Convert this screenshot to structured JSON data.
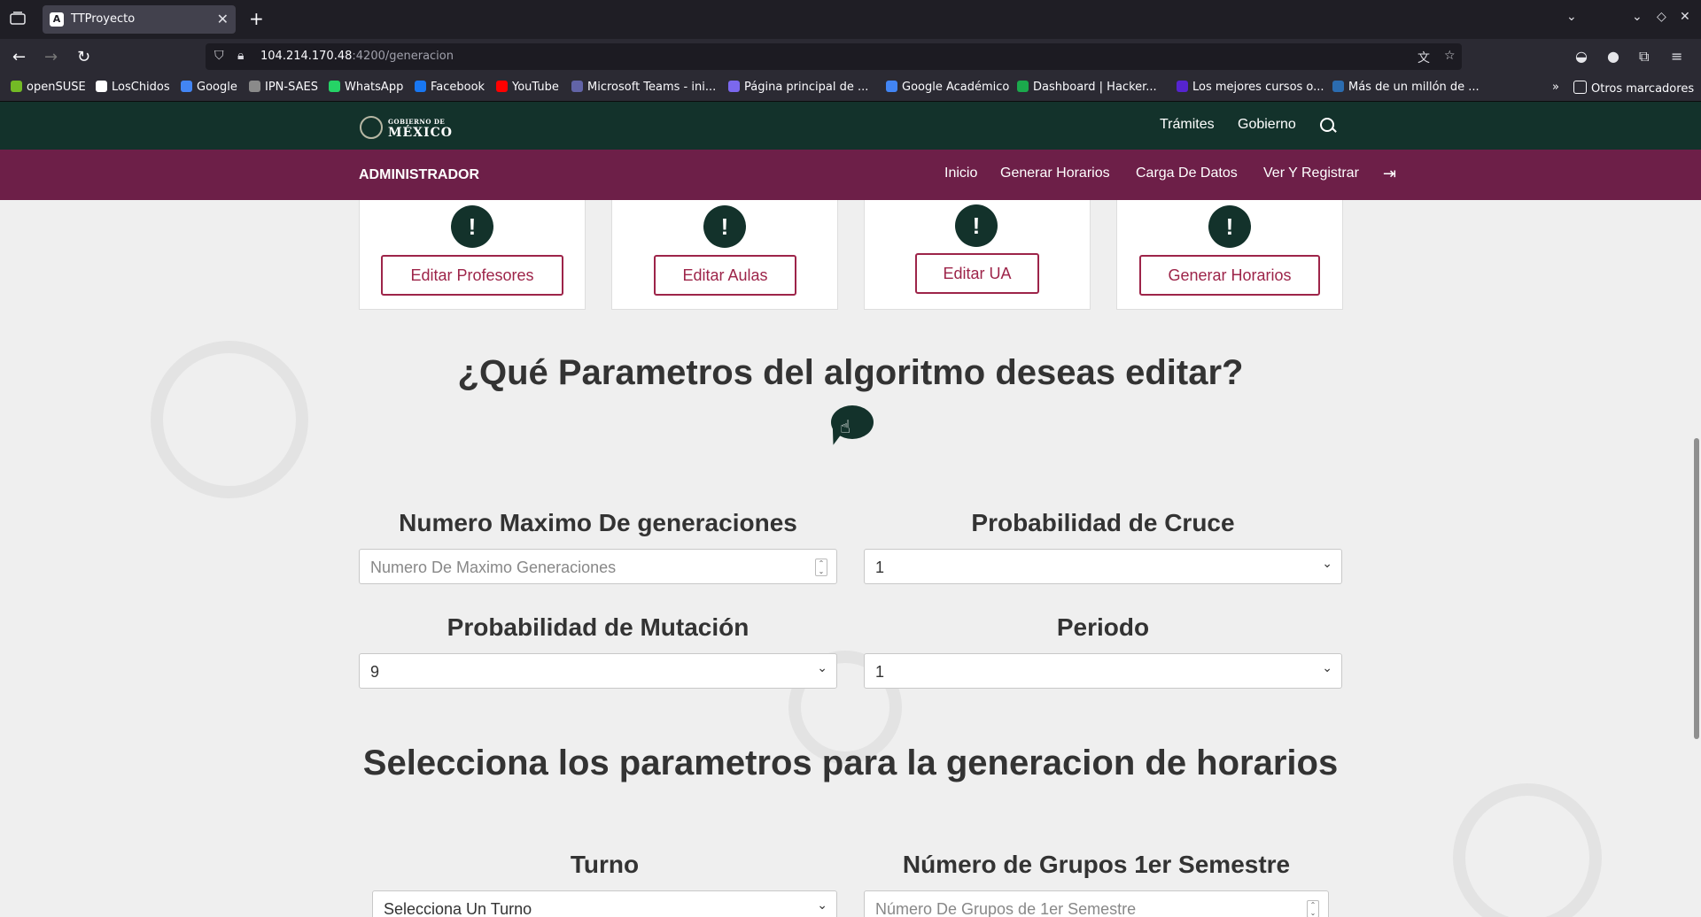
{
  "browser": {
    "tab_title": "TTProyecto",
    "tab_favicon_letter": "A",
    "url_host": "104.214.170.48",
    "url_path": ":4200/generacion",
    "bookmarks": [
      {
        "label": "openSUSE",
        "color": "#73ba25"
      },
      {
        "label": "LosChidos",
        "color": "#ffffff"
      },
      {
        "label": "Google",
        "color": "#4285f4"
      },
      {
        "label": "IPN-SAES",
        "color": "#8a8a8a"
      },
      {
        "label": "WhatsApp",
        "color": "#25d366"
      },
      {
        "label": "Facebook",
        "color": "#1877f2"
      },
      {
        "label": "YouTube",
        "color": "#ff0000"
      },
      {
        "label": "Microsoft Teams - ini...",
        "color": "#6264a7"
      },
      {
        "label": "Página principal de ...",
        "color": "#7b68ee"
      },
      {
        "label": "Google Académico",
        "color": "#4285f4"
      },
      {
        "label": "Dashboard | Hacker...",
        "color": "#1ba94c"
      },
      {
        "label": "Los mejores cursos o...",
        "color": "#5624d0"
      },
      {
        "label": "Más de un millón de ...",
        "color": "#2b6cb0"
      }
    ],
    "other_bookmarks": "Otros marcadores"
  },
  "gov": {
    "logo_small": "GOBIERNO DE",
    "logo_big": "MÉXICO",
    "links": [
      "Trámites",
      "Gobierno"
    ]
  },
  "admin": {
    "title": "ADMINISTRADOR",
    "links": [
      "Inicio",
      "Generar Horarios",
      "Carga De Datos",
      "Ver Y Registrar"
    ]
  },
  "cards": [
    {
      "alert": "!",
      "button": "Editar Profesores"
    },
    {
      "alert": "!",
      "button": "Editar Aulas"
    },
    {
      "alert": "!",
      "button": "Editar UA"
    },
    {
      "alert": "!",
      "button": "Generar Horarios"
    }
  ],
  "section1": {
    "title": "¿Qué Parametros del algoritmo deseas editar?",
    "fields": [
      {
        "label": "Numero Maximo De generaciones",
        "placeholder": "Numero De Maximo Generaciones",
        "value": ""
      },
      {
        "label": "Probabilidad de Cruce",
        "value": "1"
      },
      {
        "label": "Probabilidad de Mutación",
        "value": "9"
      },
      {
        "label": "Periodo",
        "value": "1"
      }
    ]
  },
  "section2": {
    "title": "Selecciona los parametros para la generacion de horarios",
    "fields": [
      {
        "label": "Turno",
        "value": "Selecciona Un Turno"
      },
      {
        "label": "Número de Grupos 1er Semestre",
        "placeholder": "Número De Grupos de 1er Semestre"
      }
    ]
  },
  "colors": {
    "gov_green": "#13322b",
    "admin_purple": "#6d1f48",
    "button_accent": "#9d2449"
  }
}
